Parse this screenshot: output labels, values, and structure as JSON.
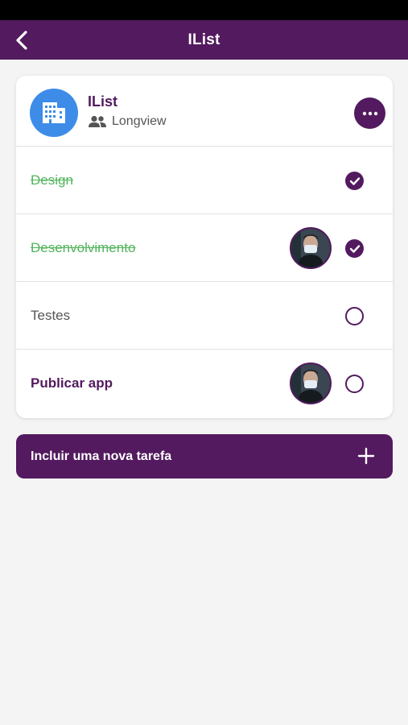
{
  "header": {
    "title": "IList",
    "back_icon": "chevron-left-icon"
  },
  "list": {
    "name": "IList",
    "group": "Longview",
    "avatar_icon": "building-icon",
    "group_icon": "people-icon",
    "menu_icon": "more-horizontal-icon"
  },
  "tasks": [
    {
      "label": "Design",
      "completed": true,
      "assigned": false
    },
    {
      "label": "Desenvolvimento",
      "completed": true,
      "assigned": true
    },
    {
      "label": "Testes",
      "completed": false,
      "assigned": false
    },
    {
      "label": "Publicar app",
      "completed": false,
      "assigned": true
    }
  ],
  "add_task": {
    "label": "Incluir uma nova tarefa",
    "icon": "plus-icon"
  },
  "colors": {
    "primary": "#531a5f",
    "done_text": "#52b45c",
    "avatar_bg": "#3d8ce8",
    "background": "#f4f4f4"
  }
}
